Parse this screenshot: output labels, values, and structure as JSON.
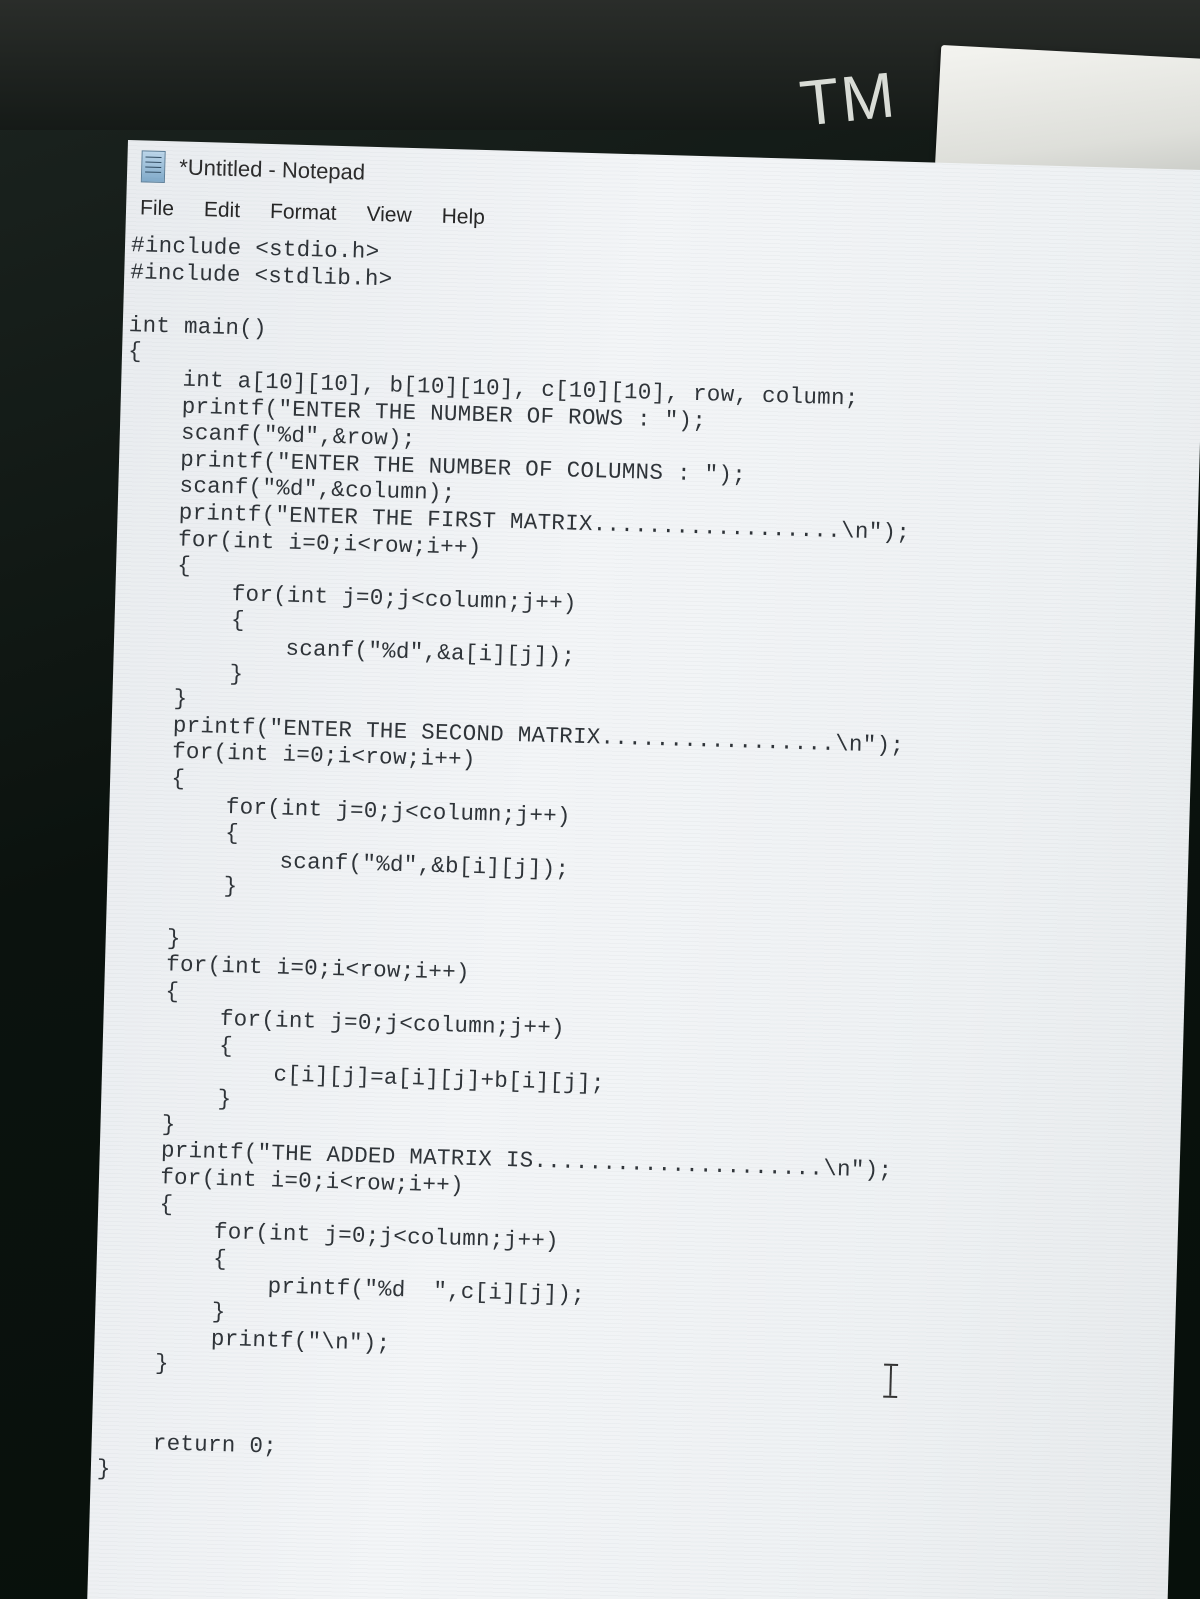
{
  "sticker": {
    "text": "TM"
  },
  "window": {
    "title": "*Untitled - Notepad",
    "icon": "notepad-icon"
  },
  "menubar": {
    "items": [
      {
        "label": "File"
      },
      {
        "label": "Edit"
      },
      {
        "label": "Format"
      },
      {
        "label": "View"
      },
      {
        "label": "Help"
      }
    ]
  },
  "editor": {
    "lines": [
      "#include <stdio.h>",
      "#include <stdlib.h>",
      "",
      "int main()",
      "{",
      "    int a[10][10], b[10][10], c[10][10], row, column;",
      "    printf(\"ENTER THE NUMBER OF ROWS : \");",
      "    scanf(\"%d\",&row);",
      "    printf(\"ENTER THE NUMBER OF COLUMNS : \");",
      "    scanf(\"%d\",&column);",
      "    printf(\"ENTER THE FIRST MATRIX..................\\n\");",
      "    for(int i=0;i<row;i++)",
      "    {",
      "        for(int j=0;j<column;j++)",
      "        {",
      "            scanf(\"%d\",&a[i][j]);",
      "        }",
      "    }",
      "    printf(\"ENTER THE SECOND MATRIX.................\\n\");",
      "    for(int i=0;i<row;i++)",
      "    {",
      "        for(int j=0;j<column;j++)",
      "        {",
      "            scanf(\"%d\",&b[i][j]);",
      "        }",
      "",
      "    }",
      "    for(int i=0;i<row;i++)",
      "    {",
      "        for(int j=0;j<column;j++)",
      "        {",
      "            c[i][j]=a[i][j]+b[i][j];",
      "        }",
      "    }",
      "    printf(\"THE ADDED MATRIX IS.....................\\n\");",
      "    for(int i=0;i<row;i++)",
      "    {",
      "        for(int j=0;j<column;j++)",
      "        {",
      "            printf(\"%d  \",c[i][j]);",
      "        }",
      "        printf(\"\\n\");",
      "    }",
      "",
      "",
      "    return 0;",
      "}"
    ]
  }
}
